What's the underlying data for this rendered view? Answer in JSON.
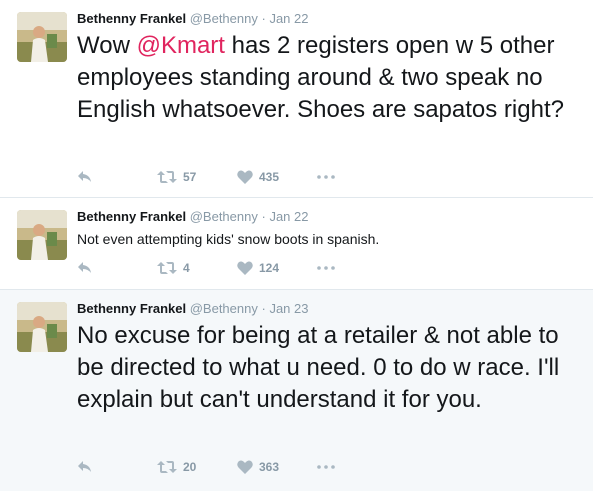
{
  "tweets": [
    {
      "name": "Bethenny Frankel",
      "handle": "@Bethenny",
      "separator": "·",
      "time": "Jan 22",
      "text_before": "Wow ",
      "mention": "@Kmart",
      "text_after": " has 2 registers open w 5 other employees standing around & two speak no English whatsoever. Shoes are sapatos right?",
      "retweets": "57",
      "likes": "435"
    },
    {
      "name": "Bethenny Frankel",
      "handle": "@Bethenny",
      "separator": "·",
      "time": "Jan 22",
      "text": "Not even attempting kids' snow boots in spanish.",
      "retweets": "4",
      "likes": "124"
    },
    {
      "name": "Bethenny Frankel",
      "handle": "@Bethenny",
      "separator": "·",
      "time": "Jan 23",
      "text": "No excuse for being at a retailer & not able to be directed to what u need. 0 to do w race. I'll explain but can't understand it for you.",
      "retweets": "20",
      "likes": "363"
    }
  ],
  "icons": {
    "reply": "reply-icon",
    "retweet": "retweet-icon",
    "like": "heart-icon",
    "more": "more-icon"
  },
  "colors": {
    "mention": "#e0245e",
    "muted": "#8899a6",
    "highlight_bg": "#f5f8fa",
    "divider": "#e1e8ed"
  }
}
